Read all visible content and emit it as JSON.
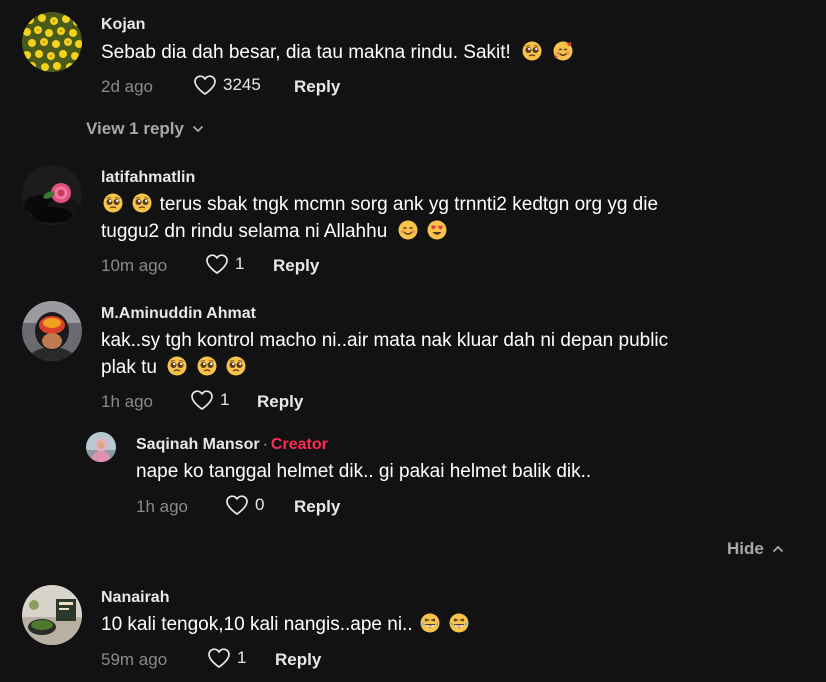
{
  "comments": [
    {
      "username": "Kojan",
      "text": "Sebab dia dah besar, dia tau makna rindu. Sakit!",
      "time": "2d ago",
      "likes": "3245",
      "reply_label": "Reply",
      "view_replies": "View 1 reply"
    },
    {
      "username": "latifahmatlin",
      "text_line1": "terus sbak tngk mcmn sorg ank yg trnnti2 kedtgn org yg die",
      "text_line2": "tuggu2 dn rindu selama ni Allahhu",
      "time": "10m ago",
      "likes": "1",
      "reply_label": "Reply"
    },
    {
      "username": "M.Aminuddin Ahmat",
      "text_line1": "kak..sy tgh kontrol macho ni..air mata nak kluar dah ni depan public",
      "text_line2": "plak tu",
      "time": "1h ago",
      "likes": "1",
      "reply_label": "Reply",
      "reply": {
        "username": "Saqinah Mansor",
        "separator": "·",
        "badge": "Creator",
        "text": "nape ko tanggal helmet dik.. gi pakai helmet balik dik..",
        "time": "1h ago",
        "likes": "0",
        "reply_label": "Reply"
      },
      "hide_label": "Hide"
    },
    {
      "username": "Nanairah",
      "text": "10 kali tengok,10 kali nangis..ape ni..",
      "time": "59m ago",
      "likes": "1",
      "reply_label": "Reply"
    }
  ],
  "colors": {
    "background": "#121212",
    "creator": "#fe2c55",
    "meta": "#8a8a8a"
  }
}
